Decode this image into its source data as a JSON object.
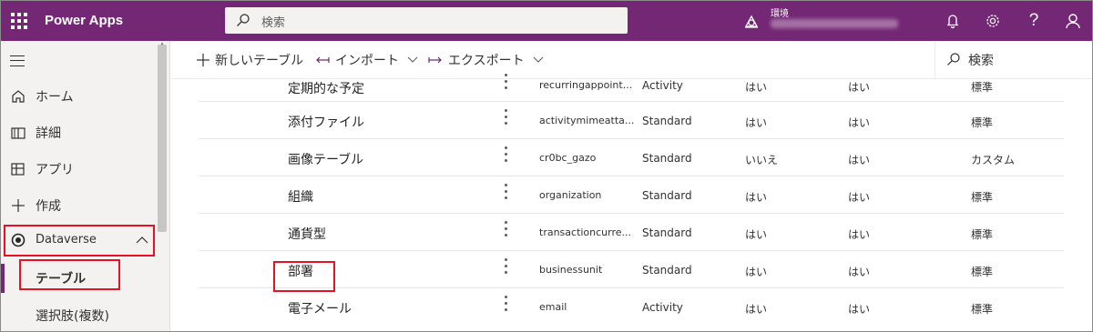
{
  "topbar": {
    "app_title": "Power Apps",
    "search_placeholder": "検索",
    "environment_label": "環境"
  },
  "sidebar": {
    "items": [
      {
        "label": "ホーム",
        "icon": "home-icon"
      },
      {
        "label": "詳細",
        "icon": "book-icon"
      },
      {
        "label": "アプリ",
        "icon": "apps-icon"
      },
      {
        "label": "作成",
        "icon": "plus-icon"
      },
      {
        "label": "Dataverse",
        "icon": "dataverse-icon"
      },
      {
        "label": "テーブル"
      },
      {
        "label": "選択肢(複数)"
      }
    ]
  },
  "commandbar": {
    "new_table": "新しいテーブル",
    "import": "インポート",
    "export": "エクスポート",
    "search_placeholder": "検索"
  },
  "table": {
    "rows": [
      {
        "name": "定期的な予定",
        "logical": "recurringappoint...",
        "type": "Activity",
        "a": "はい",
        "b": "はい",
        "c": "標準"
      },
      {
        "name": "添付ファイル",
        "logical": "activitymimeatta...",
        "type": "Standard",
        "a": "はい",
        "b": "はい",
        "c": "標準"
      },
      {
        "name": "画像テーブル",
        "logical": "cr0bc_gazo",
        "type": "Standard",
        "a": "いいえ",
        "b": "はい",
        "c": "カスタム"
      },
      {
        "name": "組織",
        "logical": "organization",
        "type": "Standard",
        "a": "はい",
        "b": "はい",
        "c": "標準"
      },
      {
        "name": "通貨型",
        "logical": "transactioncurre...",
        "type": "Standard",
        "a": "はい",
        "b": "はい",
        "c": "標準"
      },
      {
        "name": "部署",
        "logical": "businessunit",
        "type": "Standard",
        "a": "はい",
        "b": "はい",
        "c": "標準"
      },
      {
        "name": "電子メール",
        "logical": "email",
        "type": "Activity",
        "a": "はい",
        "b": "はい",
        "c": "標準"
      }
    ]
  },
  "colors": {
    "brand": "#742774",
    "highlight": "#e81123"
  }
}
